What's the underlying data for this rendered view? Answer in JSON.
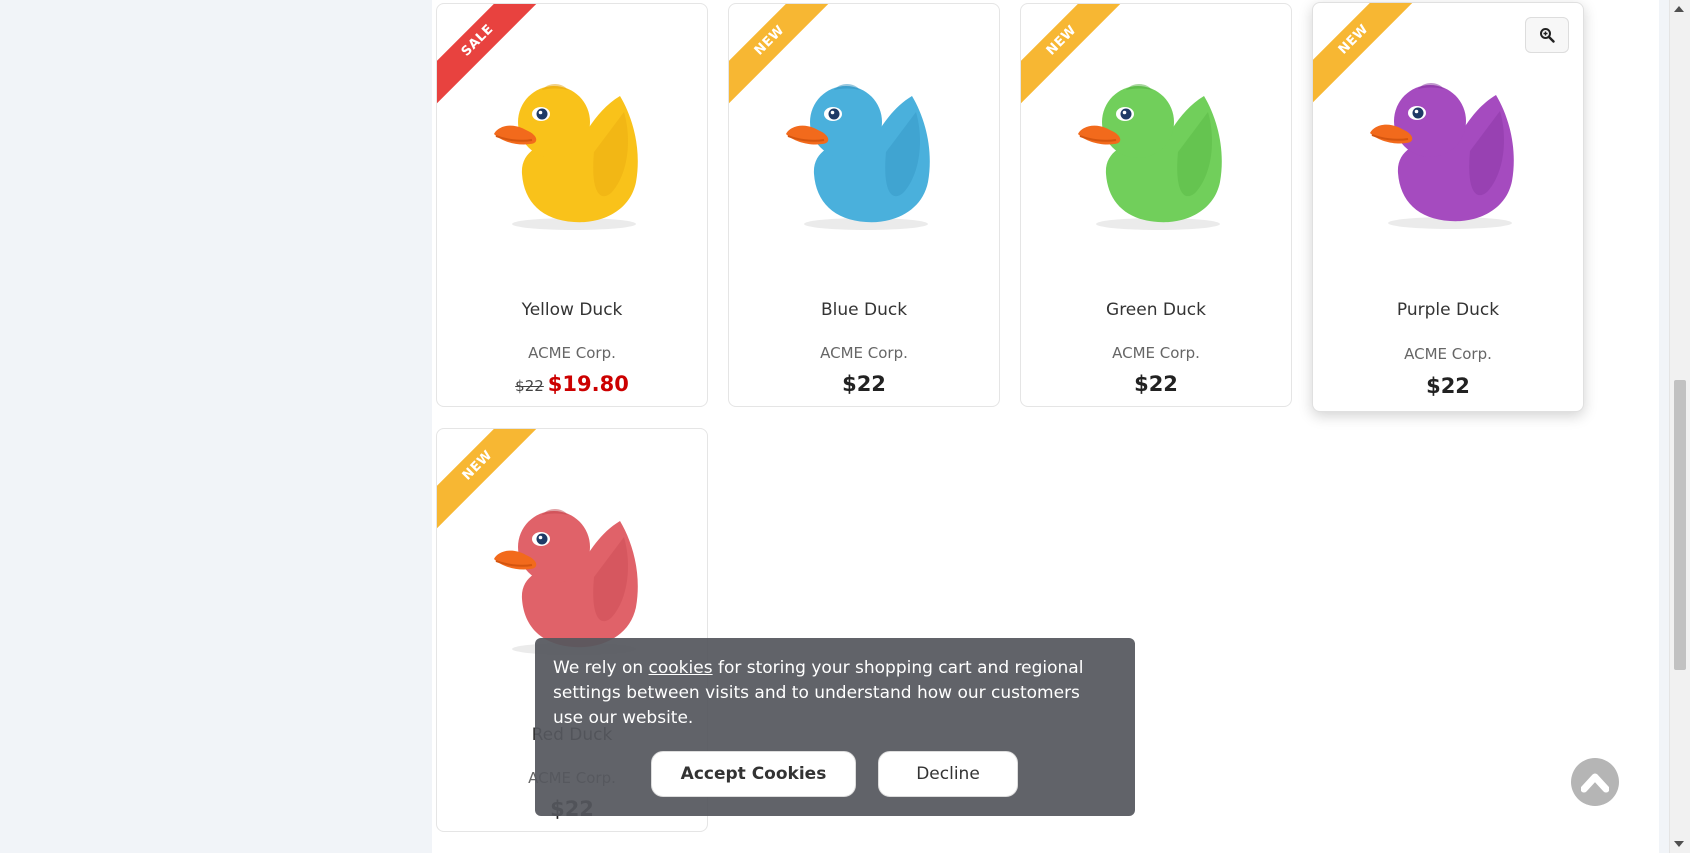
{
  "products": [
    {
      "name": "Yellow Duck",
      "manufacturer": "ACME Corp.",
      "badge": "SALE",
      "badge_color": "#e8423f",
      "regular_price": "$22",
      "campaign_price": "$19.80",
      "price": "",
      "duck_color": "#f9c21a",
      "duck_shade": "#e5a40e"
    },
    {
      "name": "Blue Duck",
      "manufacturer": "ACME Corp.",
      "badge": "NEW",
      "badge_color": "#f7b733",
      "price": "$22",
      "duck_color": "#4ab0dc",
      "duck_shade": "#2f8fbd"
    },
    {
      "name": "Green Duck",
      "manufacturer": "ACME Corp.",
      "badge": "NEW",
      "badge_color": "#f7b733",
      "price": "$22",
      "duck_color": "#71cf5b",
      "duck_shade": "#4fae3b"
    },
    {
      "name": "Purple Duck",
      "manufacturer": "ACME Corp.",
      "badge": "NEW",
      "badge_color": "#f7b733",
      "price": "$22",
      "duck_color": "#a54bbf",
      "duck_shade": "#82309b"
    },
    {
      "name": "Red Duck",
      "manufacturer": "ACME Corp.",
      "badge": "NEW",
      "badge_color": "#f7b733",
      "price": "$22",
      "duck_color": "#e06269",
      "duck_shade": "#c4454d"
    }
  ],
  "cookie_notice": {
    "text_before": "We rely on ",
    "link": "cookies",
    "text_after": " for storing your shopping cart and regional settings between visits and to understand how our customers use our website.",
    "accept_label": "Accept Cookies",
    "decline_label": "Decline"
  },
  "icons": {
    "zoom": "magnifier-icon",
    "scroll_top": "chevron-up-icon"
  }
}
